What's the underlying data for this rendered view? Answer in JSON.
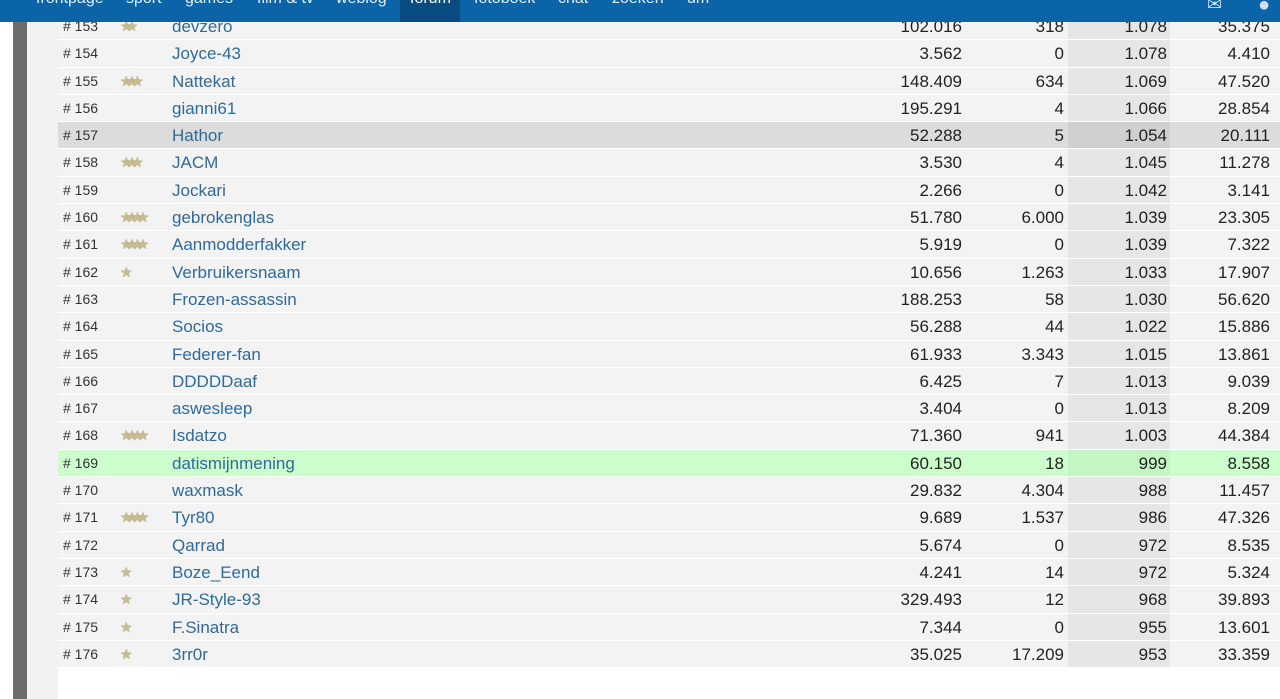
{
  "nav": {
    "items": [
      "frontpage",
      "sport",
      "games",
      "film & tv",
      "weblog",
      "forum",
      "fotoboek",
      "chat",
      "zoeken",
      "dm"
    ],
    "active": "forum"
  },
  "icons": {
    "mail": "mail-icon",
    "chat": "chat-bubble-icon",
    "rank_star": "star-icon"
  },
  "colors": {
    "topbar": "#0b63a8",
    "link": "#2f6a9a",
    "highlight_row": "#dcdcdc",
    "own_row": "#ccffcc"
  },
  "rows": [
    {
      "rank": "# 153",
      "stars": 2,
      "name": "devzero",
      "v1": "102.016",
      "v2": "318",
      "v3": "1.078",
      "v4": "35.375"
    },
    {
      "rank": "# 154",
      "stars": 0,
      "name": "Joyce-43",
      "v1": "3.562",
      "v2": "0",
      "v3": "1.078",
      "v4": "4.410"
    },
    {
      "rank": "# 155",
      "stars": 3,
      "name": "Nattekat",
      "v1": "148.409",
      "v2": "634",
      "v3": "1.069",
      "v4": "47.520"
    },
    {
      "rank": "# 156",
      "stars": 0,
      "name": "gianni61",
      "v1": "195.291",
      "v2": "4",
      "v3": "1.066",
      "v4": "28.854"
    },
    {
      "rank": "# 157",
      "stars": 0,
      "name": "Hathor",
      "v1": "52.288",
      "v2": "5",
      "v3": "1.054",
      "v4": "20.111",
      "state": "hl"
    },
    {
      "rank": "# 158",
      "stars": 3,
      "name": "JACM",
      "v1": "3.530",
      "v2": "4",
      "v3": "1.045",
      "v4": "11.278"
    },
    {
      "rank": "# 159",
      "stars": 0,
      "name": "Jockari",
      "v1": "2.266",
      "v2": "0",
      "v3": "1.042",
      "v4": "3.141"
    },
    {
      "rank": "# 160",
      "stars": 4,
      "name": "gebrokenglas",
      "v1": "51.780",
      "v2": "6.000",
      "v3": "1.039",
      "v4": "23.305"
    },
    {
      "rank": "# 161",
      "stars": 4,
      "name": "Aanmodderfakker",
      "v1": "5.919",
      "v2": "0",
      "v3": "1.039",
      "v4": "7.322"
    },
    {
      "rank": "# 162",
      "stars": 1,
      "name": "Verbruikersnaam",
      "v1": "10.656",
      "v2": "1.263",
      "v3": "1.033",
      "v4": "17.907"
    },
    {
      "rank": "# 163",
      "stars": 0,
      "name": "Frozen-assassin",
      "v1": "188.253",
      "v2": "58",
      "v3": "1.030",
      "v4": "56.620"
    },
    {
      "rank": "# 164",
      "stars": 0,
      "name": "Socios",
      "v1": "56.288",
      "v2": "44",
      "v3": "1.022",
      "v4": "15.886"
    },
    {
      "rank": "# 165",
      "stars": 0,
      "name": "Federer-fan",
      "v1": "61.933",
      "v2": "3.343",
      "v3": "1.015",
      "v4": "13.861"
    },
    {
      "rank": "# 166",
      "stars": 0,
      "name": "DDDDDaaf",
      "v1": "6.425",
      "v2": "7",
      "v3": "1.013",
      "v4": "9.039"
    },
    {
      "rank": "# 167",
      "stars": 0,
      "name": "aswesleep",
      "v1": "3.404",
      "v2": "0",
      "v3": "1.013",
      "v4": "8.209"
    },
    {
      "rank": "# 168",
      "stars": 4,
      "name": "Isdatzo",
      "v1": "71.360",
      "v2": "941",
      "v3": "1.003",
      "v4": "44.384"
    },
    {
      "rank": "# 169",
      "stars": 0,
      "name": "datismijnmening",
      "v1": "60.150",
      "v2": "18",
      "v3": "999",
      "v4": "8.558",
      "state": "me"
    },
    {
      "rank": "# 170",
      "stars": 0,
      "name": "waxmask",
      "v1": "29.832",
      "v2": "4.304",
      "v3": "988",
      "v4": "11.457"
    },
    {
      "rank": "# 171",
      "stars": 4,
      "name": "Tyr80",
      "v1": "9.689",
      "v2": "1.537",
      "v3": "986",
      "v4": "47.326"
    },
    {
      "rank": "# 172",
      "stars": 0,
      "name": "Qarrad",
      "v1": "5.674",
      "v2": "0",
      "v3": "972",
      "v4": "8.535"
    },
    {
      "rank": "# 173",
      "stars": 1,
      "name": "Boze_Eend",
      "v1": "4.241",
      "v2": "14",
      "v3": "972",
      "v4": "5.324"
    },
    {
      "rank": "# 174",
      "stars": 1,
      "name": "JR-Style-93",
      "v1": "329.493",
      "v2": "12",
      "v3": "968",
      "v4": "39.893"
    },
    {
      "rank": "# 175",
      "stars": 1,
      "name": "F.Sinatra",
      "v1": "7.344",
      "v2": "0",
      "v3": "955",
      "v4": "13.601"
    },
    {
      "rank": "# 176",
      "stars": 1,
      "name": "3rr0r",
      "v1": "35.025",
      "v2": "17.209",
      "v3": "953",
      "v4": "33.359"
    }
  ]
}
